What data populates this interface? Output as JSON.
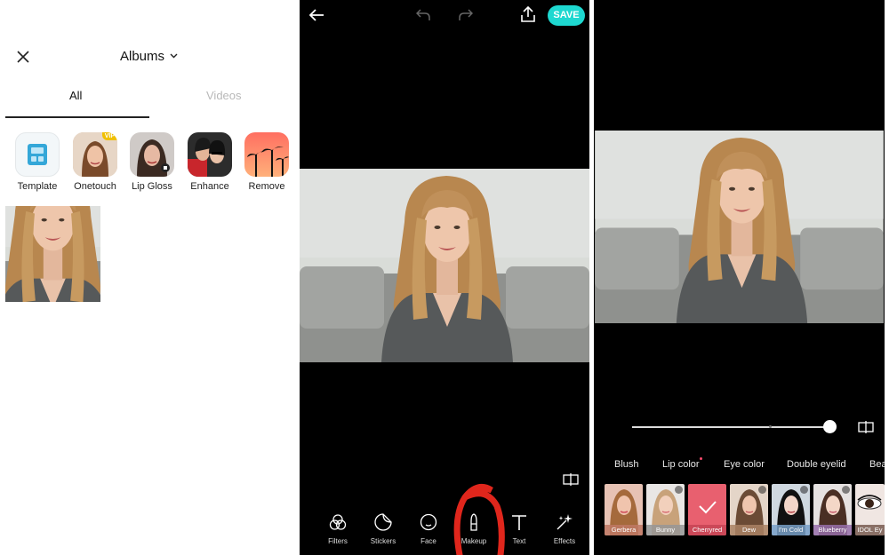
{
  "gallery": {
    "header": {
      "title": "Albums"
    },
    "tabs": [
      {
        "label": "All"
      },
      {
        "label": "Videos"
      }
    ],
    "tools": [
      {
        "label": "Template",
        "icon": "template-icon"
      },
      {
        "label": "Onetouch",
        "icon": "portrait-thumbnail",
        "badge": "VIP"
      },
      {
        "label": "Lip Gloss",
        "icon": "portrait-thumbnail"
      },
      {
        "label": "Enhance",
        "icon": "portrait-thumbnail"
      },
      {
        "label": "Remove",
        "icon": "palm-trees-thumbnail"
      }
    ]
  },
  "editor": {
    "save_label": "SAVE",
    "tools": [
      {
        "label": "Filters",
        "icon": "filters-icon"
      },
      {
        "label": "Stickers",
        "icon": "stickers-icon"
      },
      {
        "label": "Face",
        "icon": "face-icon"
      },
      {
        "label": "Makeup",
        "icon": "makeup-icon"
      },
      {
        "label": "Text",
        "icon": "text-icon"
      },
      {
        "label": "Effects",
        "icon": "effects-icon"
      }
    ]
  },
  "makeup": {
    "intensity": 1.0,
    "categories": [
      {
        "label": "Blush"
      },
      {
        "label": "Lip color",
        "has_new_dot": true
      },
      {
        "label": "Eye color"
      },
      {
        "label": "Double eyelid"
      },
      {
        "label": "Bea"
      }
    ],
    "styles": [
      {
        "label": "Gerbera",
        "downloadable": false,
        "selected": false
      },
      {
        "label": "Bunny",
        "downloadable": true,
        "selected": false
      },
      {
        "label": "Cherryred",
        "downloadable": false,
        "selected": true
      },
      {
        "label": "Dew",
        "downloadable": true,
        "selected": false
      },
      {
        "label": "I'm Cold",
        "downloadable": true,
        "selected": false
      },
      {
        "label": "Blueberry",
        "downloadable": true,
        "selected": false
      },
      {
        "label": "IDOL Ey",
        "downloadable": false,
        "selected": false
      }
    ]
  },
  "colors": {
    "save_button": "#1ed8d0",
    "selected_style_tint": "#e8606f",
    "new_dot": "#ff4b6e",
    "annotation_marker": "#e0261c"
  }
}
